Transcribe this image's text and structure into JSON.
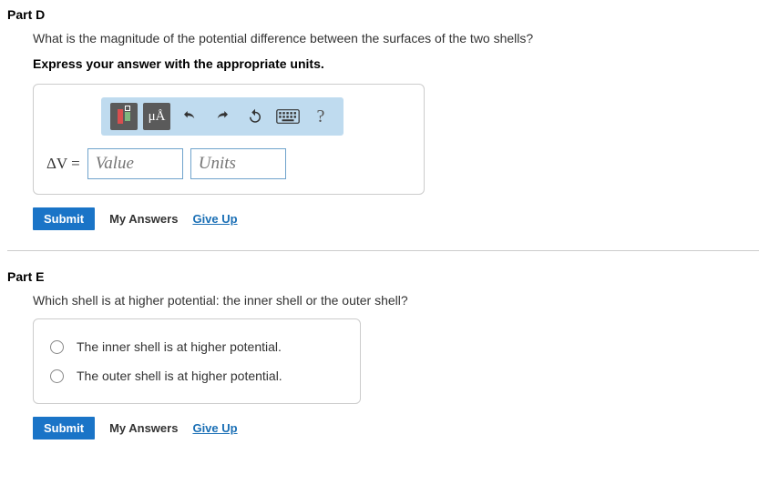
{
  "partD": {
    "title": "Part D",
    "question": "What is the magnitude of the potential difference between the surfaces of the two shells?",
    "instruction": "Express your answer with the appropriate units.",
    "toolbar": {
      "templates_icon": "templates-icon",
      "symbols_label": "μÅ",
      "undo_icon": "undo-icon",
      "redo_icon": "redo-icon",
      "reset_icon": "reset-icon",
      "keyboard_icon": "keyboard-icon",
      "help_label": "?"
    },
    "variable": "ΔV =",
    "value_placeholder": "Value",
    "units_placeholder": "Units",
    "submit_label": "Submit",
    "my_answers_label": "My Answers",
    "give_up_label": "Give Up"
  },
  "partE": {
    "title": "Part E",
    "question": "Which shell is at higher potential: the inner shell or the outer shell?",
    "choices": [
      "The inner shell is at higher potential.",
      "The outer shell is at higher potential."
    ],
    "submit_label": "Submit",
    "my_answers_label": "My Answers",
    "give_up_label": "Give Up"
  }
}
